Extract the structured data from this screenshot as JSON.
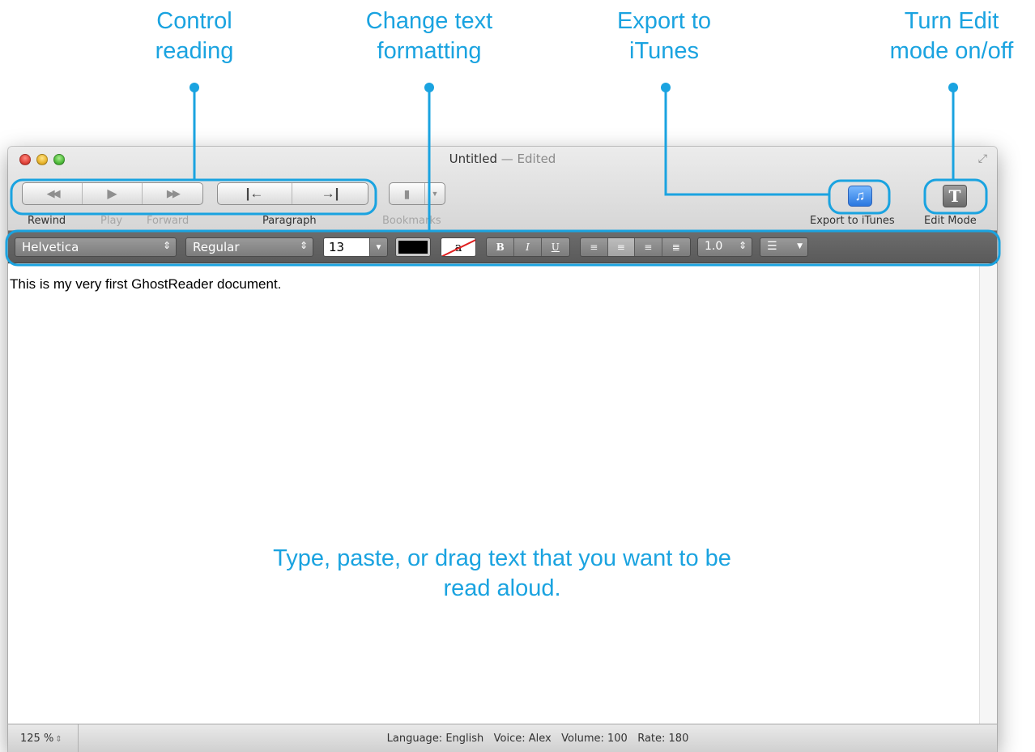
{
  "callouts": {
    "control_reading": "Control\nreading",
    "text_formatting": "Change text\nformatting",
    "export_itunes": "Export to\niTunes",
    "edit_mode": "Turn Edit\nmode on/off"
  },
  "window": {
    "title": "Untitled",
    "title_sep": " — ",
    "title_status": "Edited",
    "accent_color": "#1aa3e0"
  },
  "toolbar": {
    "rewind_label": "Rewind",
    "play_label": "Play",
    "forward_label": "Forward",
    "paragraph_label": "Paragraph",
    "bookmarks_label": "Bookmarks",
    "export_itunes_label": "Export to iTunes",
    "edit_mode_label": "Edit Mode",
    "rewind_icon": "◀◀",
    "play_icon": "▶",
    "forward_icon": "▶▶",
    "prev_paragraph_icon": "|←",
    "next_paragraph_icon": "→|",
    "itunes_icon": "♫",
    "edit_icon": "T"
  },
  "format_bar": {
    "font_family": "Helvetica",
    "font_style": "Regular",
    "font_size": "13",
    "text_color": "#000000",
    "background_color_glyph": "a",
    "bold": "B",
    "italic": "I",
    "underline": "U",
    "line_spacing": "1.0"
  },
  "document": {
    "content": "This is my very first GhostReader document.",
    "hint": "Type, paste, or drag text that you want to be read aloud."
  },
  "status": {
    "zoom": "125 %",
    "info": "Language: English   Voice: Alex   Volume: 100   Rate: 180"
  }
}
